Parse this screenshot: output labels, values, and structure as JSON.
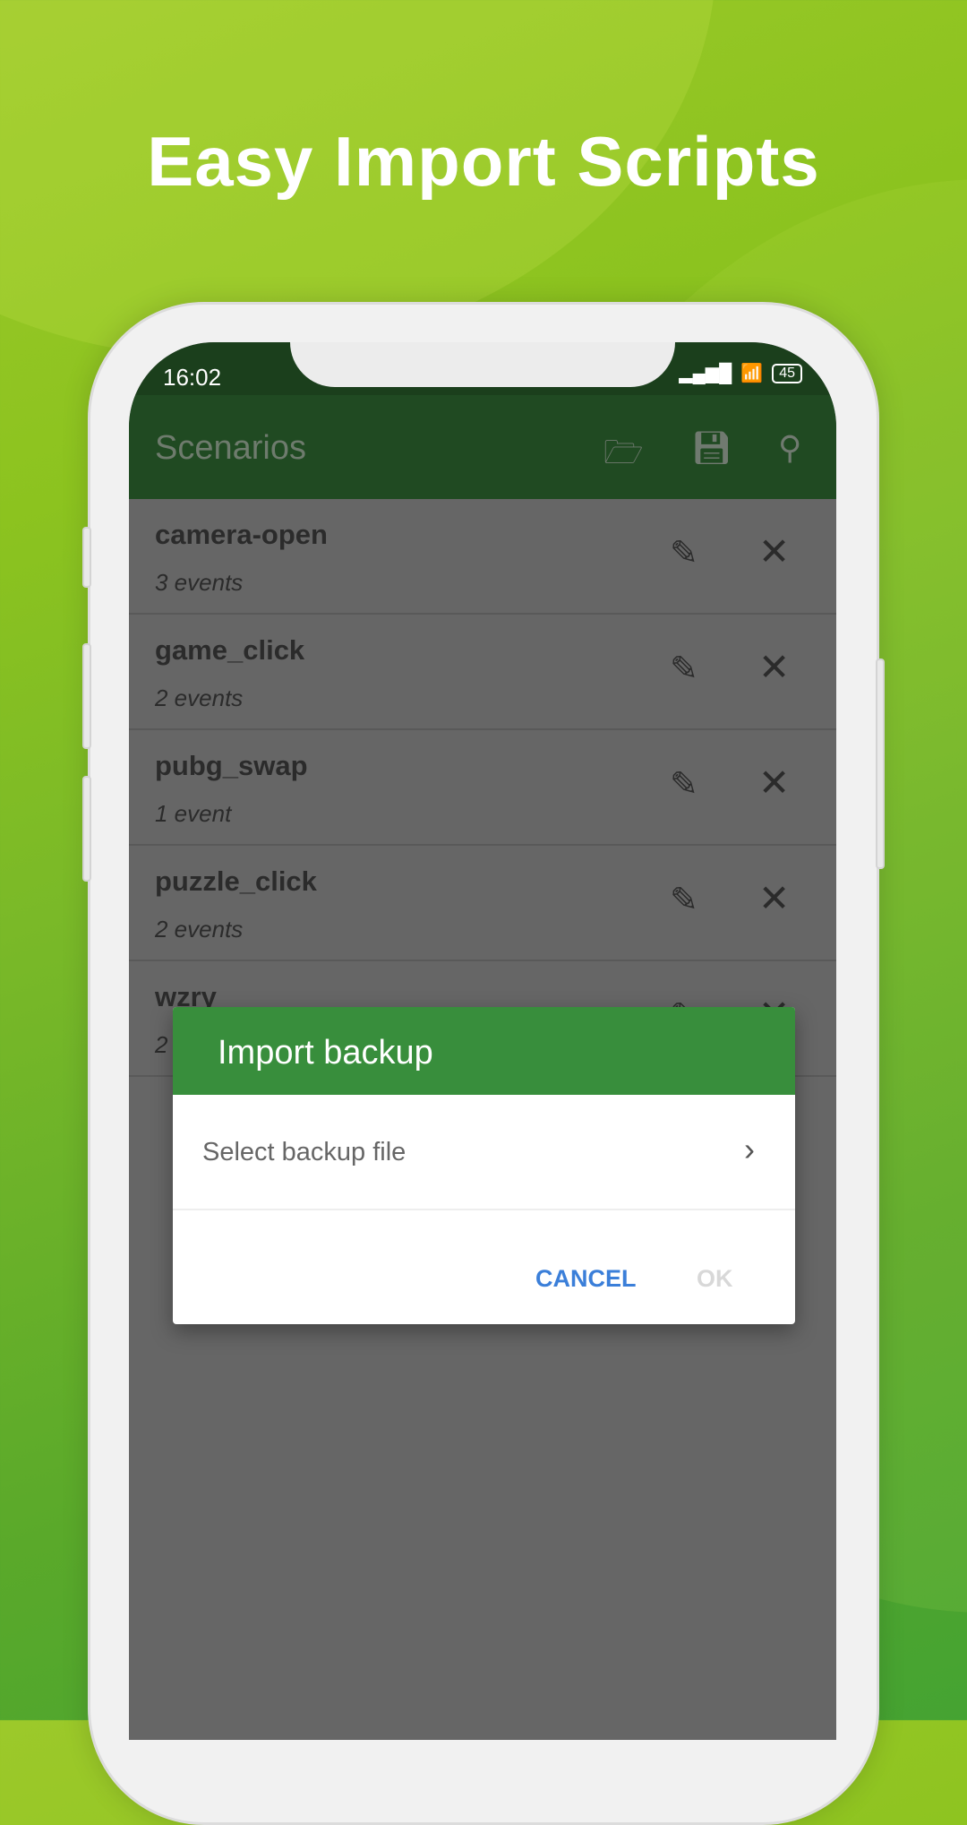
{
  "headline": "Easy Import Scripts",
  "status": {
    "time": "16:02",
    "battery": "45"
  },
  "toolbar": {
    "title": "Scenarios",
    "icons": [
      "folder-open-icon",
      "save-icon",
      "search-icon"
    ]
  },
  "scenarios": [
    {
      "name": "camera-open",
      "count": "3 events"
    },
    {
      "name": "game_click",
      "count": "2 events"
    },
    {
      "name": "pubg_swap",
      "count": "1 event"
    },
    {
      "name": "puzzle_click",
      "count": "2 events"
    },
    {
      "name": "wzry",
      "count": "2"
    }
  ],
  "dialog": {
    "title": "Import backup",
    "select_label": "Select backup file",
    "cancel": "CANCEL",
    "ok": "OK"
  },
  "colors": {
    "toolbar": "#204a22",
    "dialog_header": "#388e3c",
    "accent": "#3b7fd9"
  }
}
